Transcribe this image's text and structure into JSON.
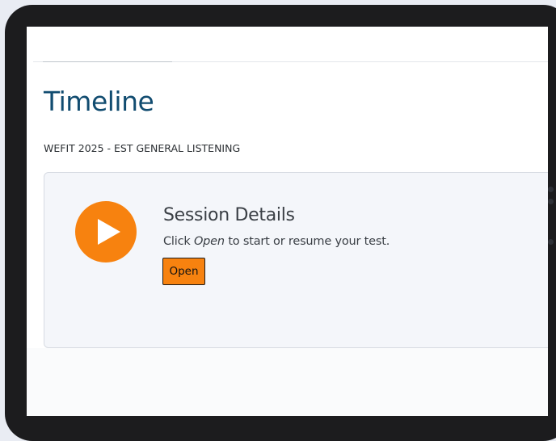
{
  "page": {
    "title": "Timeline",
    "subtitle": "WEFIT 2025 - EST GENERAL LISTENING"
  },
  "session": {
    "title": "Session Details",
    "desc_prefix": "Click ",
    "desc_emphasis": "Open",
    "desc_suffix": " to start or resume your test.",
    "open_label": "Open",
    "icon": "play-icon"
  },
  "colors": {
    "title": "#114c70",
    "accent": "#f7820f",
    "card_bg": "#f4f6fa",
    "device_frame": "#1c1c1e"
  }
}
